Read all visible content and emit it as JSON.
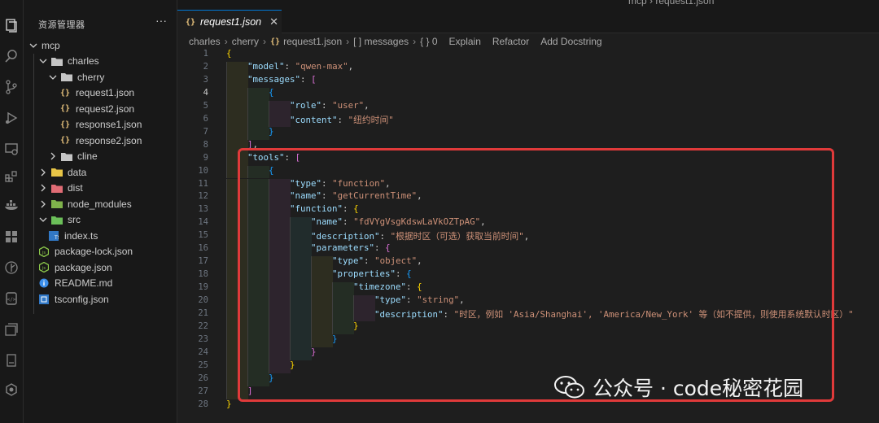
{
  "window": {
    "top_path": "mcp › request1.json"
  },
  "activity_bar": {
    "icons": [
      "files-icon",
      "search-icon",
      "source-control-icon",
      "run-debug-icon",
      "remote-explorer-icon",
      "extensions-icon",
      "docker-icon",
      "grid-icon",
      "gitlens-icon",
      "database-icon",
      "layers-icon",
      "notebook-icon",
      "settings-sync-icon"
    ]
  },
  "explorer": {
    "title": "资源管理器",
    "more": "···",
    "items": [
      {
        "label": "mcp",
        "depth": 0,
        "kind": "root",
        "open": true
      },
      {
        "label": "charles",
        "depth": 1,
        "kind": "folder",
        "open": true
      },
      {
        "label": "cherry",
        "depth": 2,
        "kind": "folder",
        "open": true
      },
      {
        "label": "request1.json",
        "depth": 3,
        "kind": "json"
      },
      {
        "label": "request2.json",
        "depth": 3,
        "kind": "json"
      },
      {
        "label": "response1.json",
        "depth": 3,
        "kind": "json"
      },
      {
        "label": "response2.json",
        "depth": 3,
        "kind": "json"
      },
      {
        "label": "cline",
        "depth": 2,
        "kind": "folder",
        "open": false
      },
      {
        "label": "data",
        "depth": 1,
        "kind": "folder-yellow",
        "open": false
      },
      {
        "label": "dist",
        "depth": 1,
        "kind": "folder-red",
        "open": false
      },
      {
        "label": "node_modules",
        "depth": 1,
        "kind": "folder-green",
        "open": false
      },
      {
        "label": "src",
        "depth": 1,
        "kind": "folder-src",
        "open": true
      },
      {
        "label": "index.ts",
        "depth": 2,
        "kind": "ts"
      },
      {
        "label": "package-lock.json",
        "depth": 1,
        "kind": "node"
      },
      {
        "label": "package.json",
        "depth": 1,
        "kind": "node"
      },
      {
        "label": "README.md",
        "depth": 1,
        "kind": "info"
      },
      {
        "label": "tsconfig.json",
        "depth": 1,
        "kind": "tsconfig"
      }
    ]
  },
  "editor": {
    "tab": {
      "label": "request1.json",
      "icon": "json-icon",
      "close": "✕"
    },
    "breadcrumb": {
      "parts": [
        "charles",
        "cherry",
        "request1.json",
        "[ ] messages",
        "{ } 0"
      ],
      "actions": [
        "Explain",
        "Refactor",
        "Add Docstring"
      ]
    },
    "line_numbers": [
      "1",
      "2",
      "3",
      "4",
      "5",
      "6",
      "7",
      "8",
      "9",
      "10",
      "11",
      "12",
      "13",
      "14",
      "15",
      "16",
      "17",
      "18",
      "19",
      "20",
      "21",
      "22",
      "23",
      "24",
      "25",
      "26",
      "27",
      "28"
    ],
    "current_line": "4",
    "lines": [
      "{",
      "    \"model\": \"qwen-max\",",
      "    \"messages\": [",
      "        {",
      "            \"role\": \"user\",",
      "            \"content\": \"纽约时间\"",
      "        }",
      "    ],",
      "    \"tools\": [",
      "        {",
      "            \"type\": \"function\",",
      "            \"name\": \"getCurrentTime\",",
      "            \"function\": {",
      "                \"name\": \"fdVYgVsgKdswLaVkOZTpAG\",",
      "                \"description\": \"根据时区（可选）获取当前时间\",",
      "                \"parameters\": {",
      "                    \"type\": \"object\",",
      "                    \"properties\": {",
      "                        \"timezone\": {",
      "                            \"type\": \"string\",",
      "                            \"description\": \"时区，例如 'Asia/Shanghai', 'America/New_York' 等（如不提供，则使用系统默认时区）\"",
      "                        }",
      "                    }",
      "                }",
      "            }",
      "        }",
      "    ]",
      "}"
    ]
  },
  "watermark": {
    "text": "公众号 · code秘密花园"
  },
  "colors": {
    "highlight_box": "#e03a3a",
    "key": "#9cdcfe",
    "string": "#ce9178",
    "bracket_gold": "#ffd700",
    "bracket_purple": "#da70d6",
    "bracket_blue": "#179fff"
  }
}
